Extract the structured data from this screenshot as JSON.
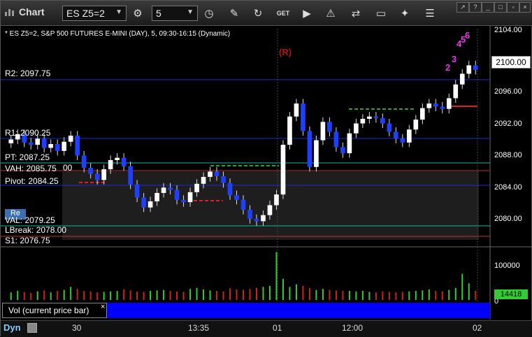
{
  "toolbar": {
    "app_title": "Chart",
    "symbol": "ES Z5=2",
    "interval": "5",
    "icons": [
      "settings-gear-icon",
      "clock-icon",
      "pencil-icon",
      "refresh-icon",
      "get-icon",
      "play-icon",
      "alert-icon",
      "transfer-icon",
      "chat-icon",
      "twitter-icon",
      "list-icon"
    ]
  },
  "chart": {
    "info": "* ES Z5=2, S&P 500 FUTURES E-MINI (DAY), 5, 09:30-16:15 (Dynamic)",
    "levels": {
      "r2": "R2: 2097.75",
      "r1": "R1: 2090.25",
      "pt": "PT: 2087.25",
      "vah": "VAH: 2085.75",
      "pivot": "Pivot: 2084.25",
      "val": "VAL: 2079.25",
      "lbreak": "LBreak: 2078.00",
      "s1": "S1: 2076.75",
      "stub": "00"
    },
    "price_axis": [
      "2104.00",
      "2096.00",
      "2092.00",
      "2088.00",
      "2084.00",
      "2080.00"
    ],
    "last_price": "2100.00",
    "marker_r": "(R)",
    "seq_labels": [
      "2",
      "3",
      "4",
      "5",
      "6"
    ],
    "re_button": "Re"
  },
  "volume": {
    "label": "Vol (current price bar)",
    "close": "×",
    "axis": "100000",
    "axis_low": "0",
    "last": "14418"
  },
  "time_axis": {
    "dyn": "Dyn",
    "ticks": [
      "30",
      "13:35",
      "01",
      "12:00",
      "02"
    ]
  },
  "chart_data": {
    "type": "candlestick",
    "ylim": [
      2077,
      2105
    ],
    "closes": [
      2090.5,
      2091.2,
      2090.1,
      2089.8,
      2090.6,
      2089.4,
      2089.9,
      2089.0,
      2090.2,
      2091.0,
      2088.4,
      2086.8,
      2086.0,
      2085.2,
      2086.6,
      2087.8,
      2088.1,
      2087.0,
      2084.6,
      2082.9,
      2081.6,
      2082.4,
      2083.5,
      2084.2,
      2083.9,
      2082.6,
      2082.3,
      2083.6,
      2084.7,
      2085.6,
      2086.3,
      2085.7,
      2084.8,
      2083.2,
      2082.6,
      2081.3,
      2080.1,
      2079.8,
      2080.6,
      2081.9,
      2083.3,
      2089.8,
      2093.5,
      2095.2,
      2091.6,
      2086.9,
      2090.4,
      2092.8,
      2091.5,
      2089.5,
      2088.7,
      2091.3,
      2092.6,
      2093.2,
      2093.5,
      2093.3,
      2092.6,
      2091.5,
      2090.6,
      2090.1,
      2091.8,
      2093.1,
      2094.6,
      2095.2,
      2094.8,
      2094.5,
      2095.9,
      2097.7,
      2099.1,
      2100.2,
      2099.6
    ],
    "volumes": [
      1500,
      1800,
      1600,
      1400,
      1700,
      1900,
      1500,
      1800,
      2000,
      2600,
      2200,
      1800,
      1700,
      1500,
      1600,
      1700,
      1800,
      2100,
      1900,
      1700,
      1600,
      1800,
      1900,
      2000,
      1800,
      1700,
      1600,
      2200,
      2400,
      2100,
      1900,
      1800,
      1700,
      2300,
      2100,
      2000,
      2200,
      2400,
      2600,
      2800,
      9500,
      4200,
      2600,
      3100,
      2800,
      2400,
      2000,
      2200,
      2000,
      1900,
      1800,
      1800,
      1700,
      1800,
      1600,
      1500,
      1700,
      1600,
      1500,
      1600,
      1700,
      1800,
      1900,
      2100,
      1800,
      1700,
      2000,
      2400,
      5200,
      3300,
      1800
    ]
  }
}
